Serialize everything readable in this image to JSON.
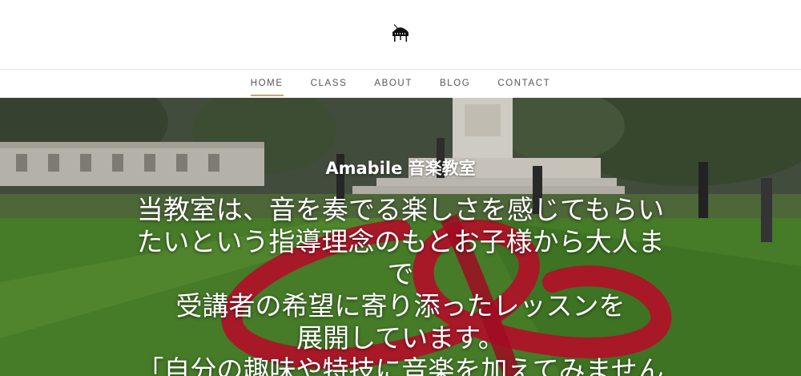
{
  "site": {
    "logo_icon": "grand-piano-icon"
  },
  "nav": {
    "items": [
      {
        "label": "HOME",
        "active": true
      },
      {
        "label": "CLASS",
        "active": false
      },
      {
        "label": "ABOUT",
        "active": false
      },
      {
        "label": "BLOG",
        "active": false
      },
      {
        "label": "CONTACT",
        "active": false
      }
    ],
    "accent_color": "#c2a878"
  },
  "hero": {
    "title": "Amabile 音楽教室",
    "lines": [
      "当教室は、音を奏でる楽しさを感じてもらい",
      "たいという指導理念のもとお子様から大人ま",
      "で",
      "受講者の希望に寄り添ったレッスンを",
      "展開しています。",
      "「自分の趣味や特技に音楽を加えてみません"
    ]
  }
}
